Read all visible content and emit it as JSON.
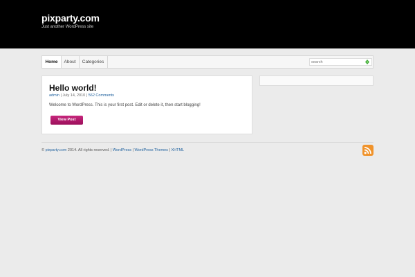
{
  "site": {
    "title": "pixparty.com",
    "tagline": "Just another WordPress site"
  },
  "nav": {
    "items": [
      {
        "label": "Home",
        "active": true
      },
      {
        "label": "About",
        "active": false
      },
      {
        "label": "Categories",
        "active": false
      }
    ]
  },
  "search": {
    "placeholder": "search",
    "button_icon": "arrow-icon"
  },
  "post": {
    "title": "Hello world!",
    "author": "admin",
    "sep1": " | ",
    "date": "July 14, 2010",
    "sep2": " | ",
    "comments": "562 Comments",
    "excerpt": "Welcome to WordPress. This is your first post. Edit or delete it, then start blogging!",
    "button_label": "View Post"
  },
  "footer": {
    "copy_symbol": "© ",
    "site_link": "pixparty.com",
    "rights": " 2014. All rights reserved. | ",
    "link_wordpress": "WordPress",
    "sep1": " | ",
    "link_themes": "WordPress Themes",
    "sep2": " | ",
    "link_xhtml": "XHTML",
    "rss_icon": "rss-icon"
  },
  "colors": {
    "header_bg": "#000000",
    "link": "#1c5f9d",
    "button": "#b01a6c",
    "rss": "#f0932b",
    "search_arrow": "#3aa532"
  }
}
